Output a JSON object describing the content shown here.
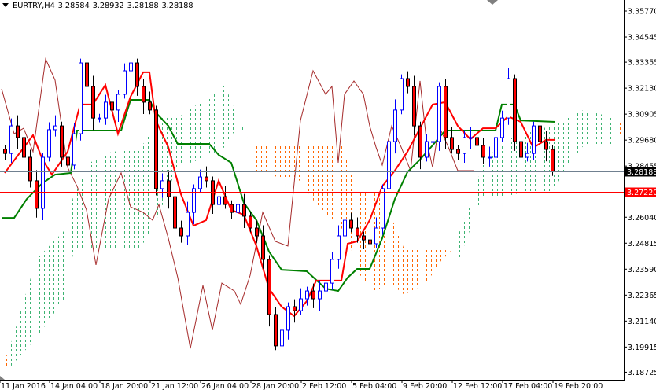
{
  "header": {
    "symbol": "EURTRY,H4",
    "open": "3.28584",
    "high": "3.28932",
    "low": "3.28188",
    "close": "3.28188"
  },
  "price_lines": {
    "bid": {
      "label": "3.28188",
      "value": 3.28188,
      "color": "#708090"
    },
    "ask": {
      "label": "3.27220",
      "value": 3.2722,
      "color": "#ff0000"
    }
  },
  "chart_data": {
    "type": "candlestick",
    "title": "EURTRY,H4",
    "timeframe": "H4",
    "bars_per_candle_sample": 2,
    "xlim_bars": [
      0,
      198
    ],
    "ylim": [
      3.1837,
      3.3629
    ],
    "grid": false,
    "y_ticks": [
      {
        "label": "3.35770",
        "value": 3.3577
      },
      {
        "label": "3.34545",
        "value": 3.34545
      },
      {
        "label": "3.33355",
        "value": 3.33355
      },
      {
        "label": "3.32130",
        "value": 3.3213
      },
      {
        "label": "3.30905",
        "value": 3.30905
      },
      {
        "label": "3.29680",
        "value": 3.2968
      },
      {
        "label": "3.28455",
        "value": 3.28455
      },
      {
        "label": "3.26040",
        "value": 3.2604
      },
      {
        "label": "3.24815",
        "value": 3.24815
      },
      {
        "label": "3.23590",
        "value": 3.2359
      },
      {
        "label": "3.22365",
        "value": 3.22365
      },
      {
        "label": "3.21140",
        "value": 3.2114
      },
      {
        "label": "3.19915",
        "value": 3.19915
      },
      {
        "label": "3.18725",
        "value": 3.18725
      }
    ],
    "x_ticks": [
      {
        "label": "11 Jan 2016",
        "bar": 0
      },
      {
        "label": "14 Jan 04:00",
        "bar": 16
      },
      {
        "label": "18 Jan 20:00",
        "bar": 32
      },
      {
        "label": "21 Jan 12:00",
        "bar": 48
      },
      {
        "label": "26 Jan 04:00",
        "bar": 64
      },
      {
        "label": "28 Jan 20:00",
        "bar": 80
      },
      {
        "label": "2 Feb 12:00",
        "bar": 96
      },
      {
        "label": "5 Feb 04:00",
        "bar": 112
      },
      {
        "label": "9 Feb 20:00",
        "bar": 128
      },
      {
        "label": "12 Feb 12:00",
        "bar": 144
      },
      {
        "label": "17 Feb 04:00",
        "bar": 160
      },
      {
        "label": "19 Feb 20:00",
        "bar": 176
      }
    ],
    "colors": {
      "bull": "#0000ff",
      "bear_body": "#ff0000",
      "bear_wick": "#000000",
      "tenkan": "#ff0000",
      "kijun": "#008000",
      "chikou": "#a52a2a",
      "cloud_bull": "#3cb371",
      "cloud_bear": "#ff6600"
    },
    "closes": [
      3.2905,
      3.3035,
      3.298,
      3.2887,
      3.2776,
      3.2646,
      3.2887,
      3.3017,
      3.3035,
      3.2887,
      3.285,
      3.2998,
      3.3332,
      3.3221,
      3.3072,
      3.3072,
      3.3147,
      3.311,
      3.3184,
      3.3295,
      3.3332,
      3.3221,
      3.3147,
      3.311,
      3.2739,
      3.2776,
      3.2701,
      3.2553,
      3.2516,
      3.2627,
      3.2739,
      3.2794,
      3.2776,
      3.2664,
      3.2701,
      3.2664,
      3.2627,
      3.2664,
      3.2609,
      3.2553,
      3.2516,
      3.2405,
      3.2145,
      3.1997,
      3.2071,
      3.2182,
      3.2163,
      3.2219,
      3.2256,
      3.2219,
      3.2256,
      3.2293,
      3.2405,
      3.2516,
      3.259,
      3.2553,
      3.2516,
      3.2497,
      3.2479,
      3.2553,
      3.2739,
      3.2961,
      3.311,
      3.3258,
      3.3221,
      3.3035,
      3.2887,
      3.2961,
      3.2961,
      3.3221,
      3.298,
      3.2924,
      3.2905,
      3.298,
      3.298,
      3.2943,
      3.2887,
      3.2887,
      3.298,
      3.3072,
      3.3258,
      3.2961,
      3.2887,
      3.2905,
      3.3035,
      3.2961,
      3.2924,
      3.28188
    ],
    "series": [
      {
        "name": "Tenkan-sen",
        "points": [
          [
            1,
            3.2813
          ],
          [
            10,
            3.2991
          ],
          [
            13,
            3.2876
          ],
          [
            16,
            3.2805
          ],
          [
            21,
            3.2913
          ],
          [
            25,
            3.3136
          ],
          [
            29,
            3.3136
          ],
          [
            33,
            3.3228
          ],
          [
            37,
            3.2998
          ],
          [
            41,
            3.3173
          ],
          [
            45,
            3.3288
          ],
          [
            47,
            3.3288
          ],
          [
            49,
            3.3061
          ],
          [
            53,
            3.2935
          ],
          [
            57,
            3.2713
          ],
          [
            61,
            3.2564
          ],
          [
            65,
            3.259
          ],
          [
            69,
            3.2776
          ],
          [
            73,
            3.2638
          ],
          [
            77,
            3.2616
          ],
          [
            81,
            3.2468
          ],
          [
            85,
            3.2267
          ],
          [
            89,
            3.2182
          ],
          [
            93,
            3.2138
          ],
          [
            97,
            3.2208
          ],
          [
            100,
            3.2305
          ],
          [
            108,
            3.2305
          ],
          [
            110,
            3.2479
          ],
          [
            113,
            3.249
          ],
          [
            117,
            3.259
          ],
          [
            121,
            3.275
          ],
          [
            125,
            3.2824
          ],
          [
            129,
            3.2913
          ],
          [
            133,
            3.3024
          ],
          [
            137,
            3.3136
          ],
          [
            141,
            3.3147
          ],
          [
            145,
            3.3035
          ],
          [
            149,
            3.2972
          ],
          [
            153,
            3.3024
          ],
          [
            157,
            3.3024
          ],
          [
            161,
            3.308
          ],
          [
            165,
            3.3054
          ],
          [
            169,
            3.2932
          ],
          [
            173,
            3.2969
          ],
          [
            176,
            3.2969
          ]
        ]
      },
      {
        "name": "Kijun-sen",
        "points": [
          [
            0,
            3.2601
          ],
          [
            4,
            3.2601
          ],
          [
            8,
            3.269
          ],
          [
            13,
            3.2765
          ],
          [
            17,
            3.2805
          ],
          [
            22,
            3.2813
          ],
          [
            24,
            3.3013
          ],
          [
            38,
            3.3013
          ],
          [
            41,
            3.3158
          ],
          [
            47,
            3.3158
          ],
          [
            49,
            3.3098
          ],
          [
            53,
            3.3035
          ],
          [
            56,
            3.295
          ],
          [
            66,
            3.295
          ],
          [
            69,
            3.2898
          ],
          [
            73,
            3.2861
          ],
          [
            77,
            3.2672
          ],
          [
            81,
            3.259
          ],
          [
            85,
            3.2442
          ],
          [
            89,
            3.2356
          ],
          [
            97,
            3.2349
          ],
          [
            103,
            3.2267
          ],
          [
            107,
            3.2256
          ],
          [
            110,
            3.2319
          ],
          [
            113,
            3.236
          ],
          [
            117,
            3.236
          ],
          [
            121,
            3.2505
          ],
          [
            125,
            3.269
          ],
          [
            129,
            3.2817
          ],
          [
            133,
            3.2876
          ],
          [
            137,
            3.2943
          ],
          [
            141,
            3.3013
          ],
          [
            157,
            3.3013
          ],
          [
            159,
            3.3136
          ],
          [
            163,
            3.3136
          ],
          [
            165,
            3.3061
          ],
          [
            176,
            3.3054
          ]
        ]
      },
      {
        "name": "Chikou Span",
        "points": [
          [
            0,
            3.321
          ],
          [
            4,
            3.2998
          ],
          [
            7,
            3.3024
          ],
          [
            10,
            3.2913
          ],
          [
            14,
            3.3351
          ],
          [
            17,
            3.3251
          ],
          [
            21,
            3.2839
          ],
          [
            24,
            3.275
          ],
          [
            27,
            3.2638
          ],
          [
            30,
            3.2379
          ],
          [
            34,
            3.269
          ],
          [
            38,
            3.2813
          ],
          [
            41,
            3.2653
          ],
          [
            45,
            3.2627
          ],
          [
            48,
            3.259
          ],
          [
            50,
            3.2664
          ],
          [
            53,
            3.2505
          ],
          [
            56,
            3.2319
          ],
          [
            60,
            3.1985
          ],
          [
            64,
            3.2282
          ],
          [
            67,
            3.2071
          ],
          [
            70,
            3.2293
          ],
          [
            74,
            3.2256
          ],
          [
            76,
            3.2193
          ],
          [
            79,
            3.233
          ],
          [
            83,
            3.2627
          ],
          [
            87,
            3.249
          ],
          [
            91,
            3.2468
          ],
          [
            95,
            3.3061
          ],
          [
            99,
            3.3295
          ],
          [
            103,
            3.3184
          ],
          [
            105,
            3.3221
          ],
          [
            107,
            3.2861
          ],
          [
            109,
            3.3184
          ],
          [
            112,
            3.3247
          ],
          [
            115,
            3.3184
          ],
          [
            117,
            3.3035
          ],
          [
            119,
            3.2935
          ],
          [
            121,
            3.285
          ],
          [
            124,
            3.3035
          ],
          [
            127,
            3.2935
          ],
          [
            130,
            3.2824
          ],
          [
            133,
            3.3247
          ],
          [
            135,
            3.2972
          ],
          [
            137,
            3.2839
          ],
          [
            139,
            3.3035
          ],
          [
            142,
            3.2935
          ],
          [
            145,
            3.2824
          ],
          [
            150,
            3.2824
          ]
        ]
      }
    ],
    "cloud": [
      {
        "kind": "bear",
        "points": [
          [
            0,
            3.1885,
            3.1941
          ],
          [
            3,
            3.19,
            3.196
          ]
        ]
      },
      {
        "kind": "bull",
        "points": [
          [
            2,
            3.196,
            3.1885
          ],
          [
            11,
            3.2405,
            3.2034
          ],
          [
            20,
            3.2542,
            3.2219
          ],
          [
            23,
            3.2713,
            3.2453
          ],
          [
            28,
            3.2861,
            3.2453
          ],
          [
            35,
            3.2913,
            3.2453
          ],
          [
            44,
            3.2924,
            3.2453
          ],
          [
            50,
            3.3073,
            3.2616
          ],
          [
            56,
            3.3073,
            3.285
          ],
          [
            60,
            3.3117,
            3.2861
          ],
          [
            65,
            3.3158,
            3.2887
          ],
          [
            71,
            3.3228,
            3.2935
          ],
          [
            75,
            3.3073,
            3.3035
          ],
          [
            78,
            3.2998,
            3.2998
          ]
        ]
      },
      {
        "kind": "bear",
        "points": [
          [
            78,
            3.2998,
            3.2998
          ],
          [
            81,
            3.2813,
            3.295
          ],
          [
            95,
            3.2776,
            3.295
          ],
          [
            100,
            3.2664,
            3.295
          ],
          [
            108,
            3.2553,
            3.295
          ],
          [
            110,
            3.2516,
            3.2861
          ],
          [
            113,
            3.2349,
            3.2727
          ],
          [
            118,
            3.2256,
            3.2727
          ],
          [
            122,
            3.2275,
            3.2664
          ],
          [
            125,
            3.2275,
            3.2564
          ],
          [
            128,
            3.2238,
            3.2453
          ],
          [
            135,
            3.2293,
            3.2453
          ],
          [
            140,
            3.2405,
            3.2453
          ],
          [
            143,
            3.2442,
            3.2442
          ]
        ]
      },
      {
        "kind": "bull",
        "points": [
          [
            143,
            3.2442,
            3.2442
          ],
          [
            145,
            3.2516,
            3.2386
          ],
          [
            150,
            3.2701,
            3.259
          ],
          [
            153,
            3.2868,
            3.2701
          ],
          [
            160,
            3.2961,
            3.2701
          ],
          [
            165,
            3.2998,
            3.272
          ],
          [
            175,
            3.3035,
            3.272
          ],
          [
            180,
            3.3073,
            3.285
          ],
          [
            185,
            3.311,
            3.2943
          ],
          [
            195,
            3.3073,
            3.2943
          ]
        ]
      },
      {
        "kind": "bear",
        "points": [
          [
            196,
            3.2998,
            3.3054
          ],
          [
            198,
            3.2998,
            3.3054
          ]
        ]
      }
    ]
  }
}
